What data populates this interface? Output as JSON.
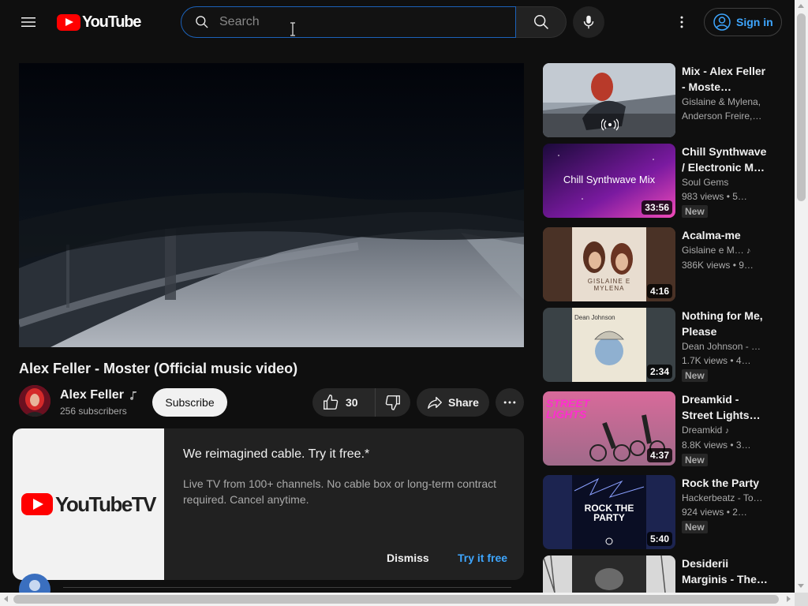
{
  "header": {
    "logo_text": "YouTube",
    "search_placeholder": "Search",
    "sign_in_label": "Sign in"
  },
  "video": {
    "title": "Alex Feller - Moster (Official music video)",
    "channel_name": "Alex Feller",
    "subscribers": "256 subscribers",
    "subscribe_label": "Subscribe",
    "likes": "30",
    "share_label": "Share"
  },
  "promo": {
    "logo_text": "YouTubeTV",
    "headline": "We reimagined cable. Try it free.*",
    "body": "Live TV from 100+ channels. No cable box or long-term contract required. Cancel anytime.",
    "dismiss_label": "Dismiss",
    "try_label": "Try it free"
  },
  "sidebar": {
    "items": [
      {
        "title": "Mix - Alex Feller - Moste…",
        "line1": "Gislaine & Mylena,",
        "line2": "Anderson Freire,…",
        "duration": "",
        "badge": "",
        "thumb_text": ""
      },
      {
        "title": "Chill Synthwave / Electronic M…",
        "line1": "Soul Gems",
        "line2": "983 views • 5…",
        "duration": "33:56",
        "badge": "New",
        "thumb_text": "Chill Synthwave Mix"
      },
      {
        "title": "Acalma-me",
        "line1": "Gislaine e M…",
        "line2": "386K views • 9…",
        "duration": "4:16",
        "badge": "",
        "thumb_text": "GISLAINE E MYLENA"
      },
      {
        "title": "Nothing for Me, Please",
        "line1": "Dean Johnson - …",
        "line2": "1.7K views • 4…",
        "duration": "2:34",
        "badge": "New",
        "thumb_text": "Dean Johnson"
      },
      {
        "title": "Dreamkid - Street Lights…",
        "line1": "Dreamkid",
        "line2": "8.8K views • 3…",
        "duration": "4:37",
        "badge": "New",
        "thumb_text": "STREET LIGHTS"
      },
      {
        "title": "Rock the Party",
        "line1": "Hackerbeatz - To…",
        "line2": "924 views • 2…",
        "duration": "5:40",
        "badge": "New",
        "thumb_text": "ROCK THE PARTY"
      },
      {
        "title": "Desiderii Marginis - The…",
        "line1": "",
        "line2": "",
        "duration": "",
        "badge": "",
        "thumb_text": ""
      }
    ]
  },
  "colors": {
    "background": "#0f0f0f",
    "accent_blue": "#3ea6ff",
    "brand_red": "#ff0000"
  }
}
